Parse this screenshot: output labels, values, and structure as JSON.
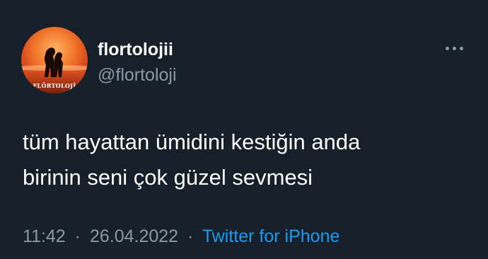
{
  "author": {
    "display_name": "flortolojii",
    "handle": "@flortoloji",
    "avatar_watermark": "FLÖRTOLOJİ"
  },
  "tweet": {
    "lines": [
      "tüm hayattan ümidini kestiğin anda",
      "birinin seni çok güzel sevmesi"
    ]
  },
  "meta": {
    "time": "11:42",
    "separator": "·",
    "date": "26.04.2022",
    "source": "Twitter for iPhone"
  },
  "icons": {
    "more": "more-horizontal-icon"
  },
  "colors": {
    "background": "#15202b",
    "text": "#ffffff",
    "secondary_text": "#8b98a5",
    "link": "#1d9bf0"
  }
}
